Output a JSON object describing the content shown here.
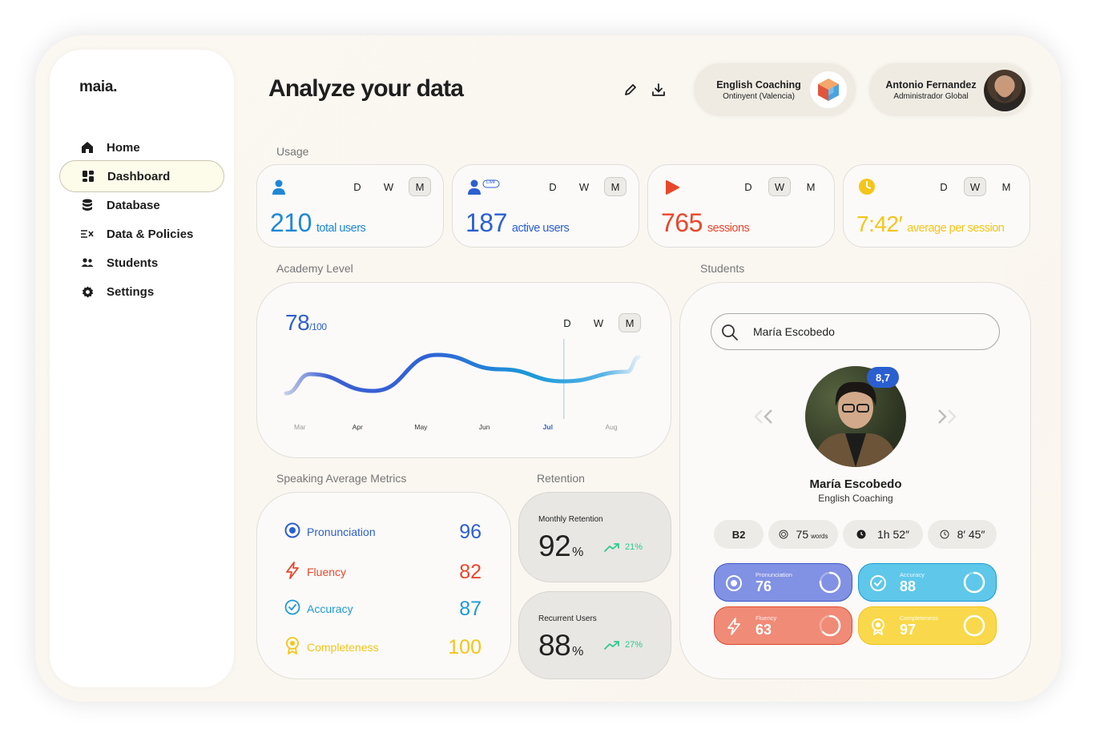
{
  "brand": {
    "logo": "maia."
  },
  "nav": [
    {
      "label": "Home",
      "icon": "home-icon"
    },
    {
      "label": "Dashboard",
      "icon": "dashboard-icon",
      "active": true
    },
    {
      "label": "Database",
      "icon": "database-icon"
    },
    {
      "label": "Data & Policies",
      "icon": "data-policies-icon"
    },
    {
      "label": "Students",
      "icon": "students-icon"
    },
    {
      "label": "Settings",
      "icon": "gear-icon"
    }
  ],
  "header": {
    "title": "Analyze your data",
    "org": {
      "name": "English Coaching",
      "location": "Ontinyent (Valencia)"
    },
    "user": {
      "name": "Antonio Fernandez",
      "role": "Administrador Global"
    }
  },
  "usage": {
    "section_label": "Usage",
    "period_options": [
      "D",
      "W",
      "M"
    ],
    "cards": [
      {
        "value": "210",
        "label": "total users",
        "color": "#1e88d6",
        "selected_period": "M",
        "icon": "user-icon"
      },
      {
        "value": "187",
        "label": "active users",
        "color": "#2b5fd0",
        "selected_period": "M",
        "icon": "live-user-icon",
        "badge": "Live"
      },
      {
        "value": "765",
        "label": "sessions",
        "color": "#e8472c",
        "selected_period": "W",
        "icon": "play-icon"
      },
      {
        "value": "7:42′",
        "label": "average per session",
        "color": "#f5c518",
        "selected_period": "W",
        "icon": "clock-icon"
      }
    ]
  },
  "academy": {
    "section_label": "Academy Level",
    "score": "78",
    "score_max": "/100",
    "selected_period": "M",
    "highlight_month": "Jul"
  },
  "chart_data": {
    "type": "line",
    "x": [
      "Mar",
      "Apr",
      "May",
      "Jun",
      "Jul",
      "Aug"
    ],
    "series": [
      {
        "values": [
          72,
          65,
          80,
          74,
          69,
          73
        ]
      }
    ],
    "ylim": [
      55,
      90
    ],
    "grid": false
  },
  "speaking": {
    "section_label": "Speaking Average Metrics",
    "metrics": [
      {
        "label": "Pronunciation",
        "value": "96",
        "color": "#2b5fd0",
        "icon": "target-icon"
      },
      {
        "label": "Fluency",
        "value": "82",
        "color": "#e8472c",
        "icon": "lightning-icon"
      },
      {
        "label": "Accuracy",
        "value": "87",
        "color": "#1e9ad6",
        "icon": "check-circle-icon"
      },
      {
        "label": "Completeness",
        "value": "100",
        "color": "#f5c518",
        "icon": "medal-icon"
      }
    ]
  },
  "retention": {
    "section_label": "Retention",
    "items": [
      {
        "label": "Monthly Retention",
        "value": "92",
        "unit": "%",
        "trend": "21%"
      },
      {
        "label": "Recurrent Users",
        "value": "88",
        "unit": "%",
        "trend": "27%"
      }
    ]
  },
  "students": {
    "section_label": "Students",
    "search_value": "María Escobedo",
    "student": {
      "name": "María Escobedo",
      "org": "English Coaching",
      "score_badge": "8,7"
    },
    "chips": [
      {
        "value": "B2",
        "icon": ""
      },
      {
        "value": "75",
        "suffix": "words",
        "icon": "target-small-icon"
      },
      {
        "value": "1h 52″",
        "icon": "clock-filled-icon"
      },
      {
        "value": "8′ 45″",
        "icon": "timer-icon"
      }
    ],
    "tiles": [
      {
        "label": "Pronunciation",
        "value": "76",
        "color": "#7f8fe3",
        "icon": "target-icon",
        "progress": 0.76
      },
      {
        "label": "Accuracy",
        "value": "88",
        "color": "#5bc6e8",
        "icon": "check-circle-icon",
        "progress": 0.88
      },
      {
        "label": "Fluency",
        "value": "63",
        "color": "#ef8a76",
        "icon": "lightning-icon",
        "progress": 0.63
      },
      {
        "label": "Completeness",
        "value": "97",
        "color": "#f8d84a",
        "icon": "medal-icon",
        "progress": 0.97
      }
    ]
  }
}
